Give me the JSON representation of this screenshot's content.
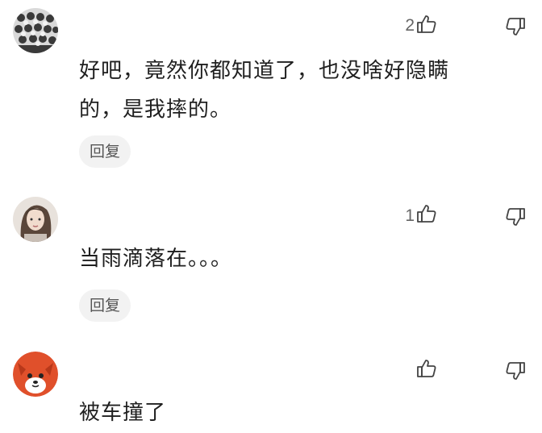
{
  "comments": [
    {
      "avatar_icon": "group-photo-avatar",
      "likes": "2",
      "text": "好吧，竟然你都知道了，也没啥好隐瞒\n的，是我摔的。",
      "reply_label": "回复"
    },
    {
      "avatar_icon": "girl-photo-avatar",
      "likes": "1",
      "text": "当雨滴落在。。。",
      "reply_label": "回复"
    },
    {
      "avatar_icon": "fox-cartoon-avatar",
      "likes": "",
      "text": "被车撞了"
    }
  ],
  "icons": {
    "like": "thumbs-up-icon",
    "dislike": "thumbs-down-icon"
  },
  "colors": {
    "text": "#1f1f1f",
    "muted": "#666666",
    "reply_bg": "#f2f2f2"
  }
}
